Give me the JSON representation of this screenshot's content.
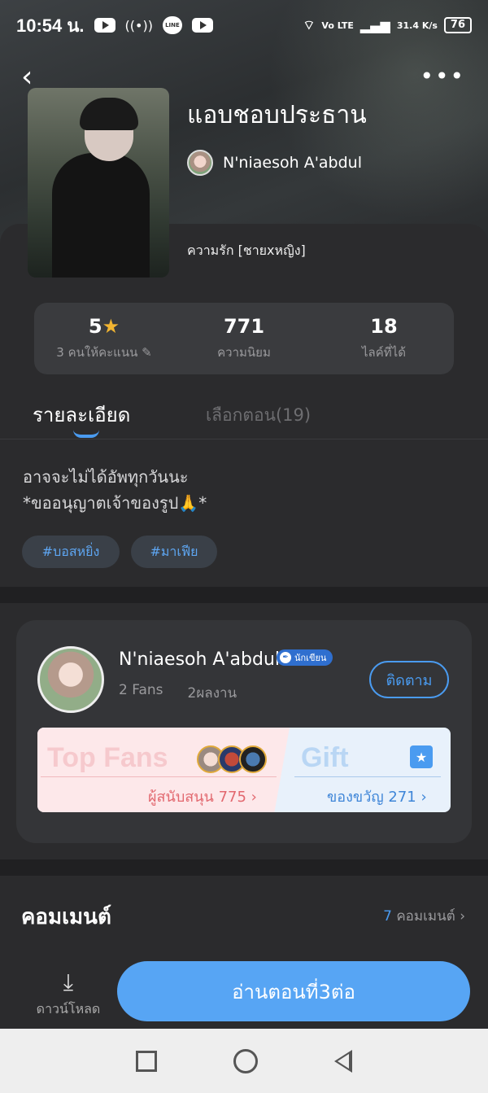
{
  "status_bar": {
    "time": "10:54 น.",
    "network": "Vo LTE",
    "speed": "31.4 K/s",
    "battery": "76"
  },
  "novel": {
    "title": "แอบชอบประธาน",
    "author": "N'niaesoh A'abdul",
    "genre": "ความรัก [ชายxหญิง]"
  },
  "stats": {
    "rating": "5",
    "rating_label": "3 คนให้คะแนน",
    "popularity": "771",
    "popularity_label": "ความนิยม",
    "likes": "18",
    "likes_label": "ไลค์ที่ได้"
  },
  "tabs": {
    "details": "รายละเอียด",
    "chapters": "เลือกตอน(19)"
  },
  "description": {
    "line1": "อาจจะไม่ได้อัพทุกวันนะ",
    "line2": "*ขออนุญาตเจ้าของรูป🙏*"
  },
  "tags": [
    "#บอสหยิ่ง",
    "#มาเฟีย"
  ],
  "author_card": {
    "name": "N'niaesoh A'abdul",
    "badge": "นักเขียน",
    "fans": "2 Fans",
    "works": "2ผลงาน",
    "follow": "ติดตาม",
    "top_fans_title": "Top Fans",
    "supporters": "ผู้สนับสนุน 775",
    "gift_title": "Gift",
    "gifts": "ของขวัญ 271"
  },
  "comments": {
    "title": "คอมเมนต์",
    "count": "7",
    "count_label": "คอมเมนต์"
  },
  "bottom": {
    "download": "ดาวน์โหลด",
    "read_button": "อ่านตอนที่3ต่อ"
  },
  "colors": {
    "accent": "#57a5f4",
    "star": "#f2b531",
    "background": "#2b2b2d"
  }
}
